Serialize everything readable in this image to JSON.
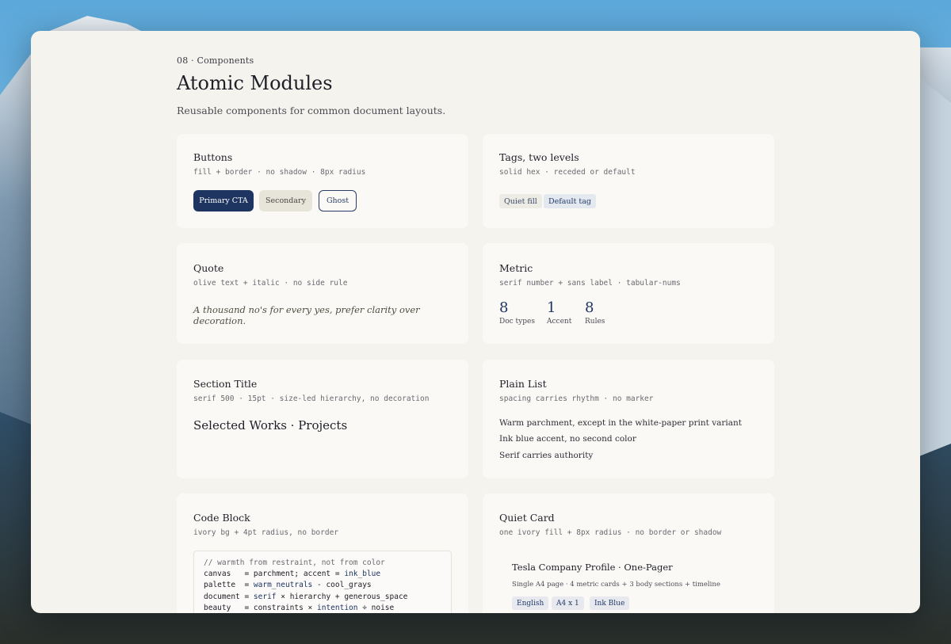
{
  "header": {
    "eyebrow": "08 · Components",
    "title": "Atomic Modules",
    "subtitle": "Reusable components for common document layouts."
  },
  "cards": {
    "buttons": {
      "title": "Buttons",
      "meta": "fill + border · no shadow · 8px radius",
      "primary": "Primary CTA",
      "secondary": "Secondary",
      "ghost": "Ghost"
    },
    "tags": {
      "title": "Tags, two levels",
      "meta": "solid hex · receded or default",
      "quiet": "Quiet fill",
      "default": "Default tag"
    },
    "quote": {
      "title": "Quote",
      "meta": "olive text + italic · no side rule",
      "text": "A thousand no's for every yes, prefer clarity over decoration."
    },
    "metric": {
      "title": "Metric",
      "meta": "serif number + sans label · tabular-nums",
      "items": [
        {
          "value": "8",
          "label": "Doc types"
        },
        {
          "value": "1",
          "label": "Accent"
        },
        {
          "value": "8",
          "label": "Rules"
        }
      ]
    },
    "section_title": {
      "title": "Section Title",
      "meta": "serif 500 · 15pt · size-led hierarchy, no decoration",
      "sample": "Selected Works · Projects"
    },
    "plain_list": {
      "title": "Plain List",
      "meta": "spacing carries rhythm · no marker",
      "items": [
        "Warm parchment, except in the white-paper print variant",
        "Ink blue accent, no second color",
        "Serif carries authority"
      ]
    },
    "code_block": {
      "title": "Code Block",
      "meta": "ivory bg + 4pt radius, no border",
      "lines": {
        "l1": "// warmth from restraint, not from color",
        "l2a": "canvas   = parchment; accent = ",
        "l2b": "ink_blue",
        "l3a": "palette  = ",
        "l3b": "warm_neutrals",
        "l3c": " - cool_grays",
        "l4a": "document = ",
        "l4b": "serif",
        "l4c": " × hierarchy + generous_space",
        "l5a": "beauty   = constraints × ",
        "l5b": "intention",
        "l5c": " ÷ noise"
      }
    },
    "quiet_card": {
      "title": "Quiet Card",
      "meta": "one ivory fill + 8px radius · no border or shadow",
      "inner_title": "Tesla Company Profile · One-Pager",
      "inner_desc": "Single A4 page · 4 metric cards + 3 body sections + timeline",
      "tags": [
        "English",
        "A4 x 1",
        "Ink Blue"
      ]
    }
  },
  "colors": {
    "ink_blue": "#1d3560",
    "parchment": "#f5f3ee",
    "card_fill": "#faf9f6"
  }
}
